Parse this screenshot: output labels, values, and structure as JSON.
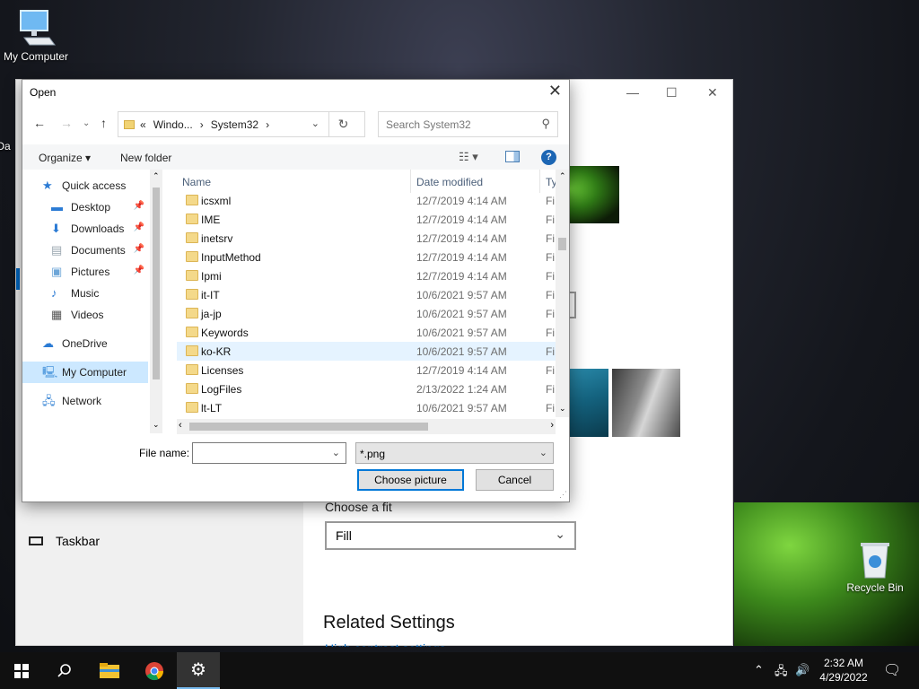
{
  "desktop": {
    "my_computer_label": "My Computer",
    "partial_label": "Da",
    "recycle_bin_label": "Recycle Bin"
  },
  "settings_window": {
    "choose_fit_label": "Choose a fit",
    "fit_value": "Fill",
    "related_settings": "Related Settings",
    "taskbar_label": "Taskbar",
    "partial_text": "High contrast settings"
  },
  "dialog": {
    "title": "Open",
    "address": {
      "overflow": "«",
      "segments": [
        "Windo...",
        "System32"
      ]
    },
    "search_placeholder": "Search System32",
    "toolbar": {
      "organize": "Organize",
      "new_folder": "New folder",
      "help": "?"
    },
    "nav": [
      {
        "label": "Quick access",
        "icon": "star-icon"
      },
      {
        "label": "Desktop",
        "icon": "desktop-folder-icon",
        "pinned": true
      },
      {
        "label": "Downloads",
        "icon": "download-arrow-icon",
        "pinned": true
      },
      {
        "label": "Documents",
        "icon": "documents-icon",
        "pinned": true
      },
      {
        "label": "Pictures",
        "icon": "pictures-icon",
        "pinned": true
      },
      {
        "label": "Music",
        "icon": "music-note-icon"
      },
      {
        "label": "Videos",
        "icon": "video-film-icon"
      },
      {
        "label": "OneDrive",
        "icon": "cloud-icon"
      },
      {
        "label": "My Computer",
        "icon": "computer-icon",
        "selected": true
      },
      {
        "label": "Network",
        "icon": "network-icon"
      }
    ],
    "columns": {
      "name": "Name",
      "date": "Date modified",
      "type": "Ty"
    },
    "rows": [
      {
        "name": "icsxml",
        "date": "12/7/2019 4:14 AM",
        "type": "Fi"
      },
      {
        "name": "IME",
        "date": "12/7/2019 4:14 AM",
        "type": "Fi"
      },
      {
        "name": "inetsrv",
        "date": "12/7/2019 4:14 AM",
        "type": "Fi"
      },
      {
        "name": "InputMethod",
        "date": "12/7/2019 4:14 AM",
        "type": "Fi"
      },
      {
        "name": "Ipmi",
        "date": "12/7/2019 4:14 AM",
        "type": "Fi"
      },
      {
        "name": "it-IT",
        "date": "10/6/2021 9:57 AM",
        "type": "Fi"
      },
      {
        "name": "ja-jp",
        "date": "10/6/2021 9:57 AM",
        "type": "Fi"
      },
      {
        "name": "Keywords",
        "date": "10/6/2021 9:57 AM",
        "type": "Fi"
      },
      {
        "name": "ko-KR",
        "date": "10/6/2021 9:57 AM",
        "type": "Fi",
        "selected": true
      },
      {
        "name": "Licenses",
        "date": "12/7/2019 4:14 AM",
        "type": "Fi"
      },
      {
        "name": "LogFiles",
        "date": "2/13/2022 1:24 AM",
        "type": "Fi"
      },
      {
        "name": "lt-LT",
        "date": "10/6/2021 9:57 AM",
        "type": "Fi"
      }
    ],
    "file_name_label": "File name:",
    "file_name_value": "",
    "file_type": "*.png",
    "choose_button": "Choose picture",
    "cancel_button": "Cancel"
  },
  "taskbar": {
    "time": "2:32 AM",
    "date": "4/29/2022"
  }
}
